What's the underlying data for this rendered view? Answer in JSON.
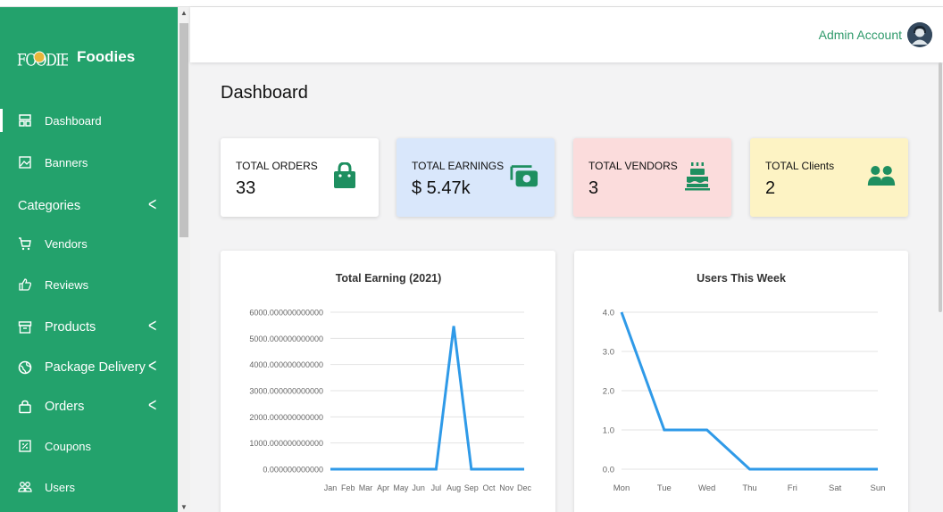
{
  "brand": {
    "name": "Foodies",
    "logo_text": "FOODIES"
  },
  "header": {
    "admin_label": "Admin Account"
  },
  "sidebar": {
    "items": [
      {
        "label": "Dashboard",
        "icon": "dashboard-icon",
        "has_chevron": false
      },
      {
        "label": "Banners",
        "icon": "image-icon",
        "has_chevron": false
      },
      {
        "label": "Categories",
        "icon": "",
        "has_chevron": true
      },
      {
        "label": "Vendors",
        "icon": "cart-icon",
        "has_chevron": false
      },
      {
        "label": "Reviews",
        "icon": "thumbs-up-icon",
        "has_chevron": false
      },
      {
        "label": "Products",
        "icon": "archive-icon",
        "has_chevron": true
      },
      {
        "label": "Package Delivery",
        "icon": "globe-icon",
        "has_chevron": true
      },
      {
        "label": "Orders",
        "icon": "bag-icon",
        "has_chevron": true
      },
      {
        "label": "Coupons",
        "icon": "coupon-icon",
        "has_chevron": false
      },
      {
        "label": "Users",
        "icon": "users-icon",
        "has_chevron": false
      }
    ],
    "chevron": "<"
  },
  "main": {
    "title": "Dashboard",
    "cards": [
      {
        "title": "TOTAL ORDERS",
        "value": "33",
        "icon": "shopping-bag-icon",
        "bg": "#ffffff"
      },
      {
        "title": "TOTAL EARNINGS",
        "value": "$ 5.47k",
        "icon": "money-icon",
        "bg": "#d9e7fb"
      },
      {
        "title": "TOTAL VENDORS",
        "value": "3",
        "icon": "cake-icon",
        "bg": "#fbdcdc"
      },
      {
        "title": "TOTAL Clients",
        "value": "2",
        "icon": "users-icon",
        "bg": "#fdf3c4"
      }
    ]
  },
  "colors": {
    "sidebar": "#23a26c",
    "accent": "#1e8f60",
    "line": "#2f9ae8"
  },
  "chart_data": [
    {
      "type": "line",
      "title": "Total Earning (2021)",
      "x": [
        "Jan",
        "Feb",
        "Mar",
        "Apr",
        "May",
        "Jun",
        "Jul",
        "Aug",
        "Sep",
        "Oct",
        "Nov",
        "Dec"
      ],
      "values": [
        0,
        0,
        0,
        0,
        0,
        0,
        0,
        5470,
        0,
        0,
        0,
        0
      ],
      "yticks": [
        "0.000000000000",
        "1000.000000000000",
        "2000.000000000000",
        "3000.000000000000",
        "4000.000000000000",
        "5000.000000000000",
        "6000.000000000000"
      ],
      "ylim": [
        0,
        6000
      ],
      "grid": true,
      "xlabel": "",
      "ylabel": ""
    },
    {
      "type": "line",
      "title": "Users This Week",
      "x": [
        "Mon",
        "Tue",
        "Wed",
        "Thu",
        "Fri",
        "Sat",
        "Sun"
      ],
      "values": [
        4,
        1,
        1,
        0,
        0,
        0,
        0
      ],
      "yticks": [
        "0.0",
        "1.0",
        "2.0",
        "3.0",
        "4.0"
      ],
      "ylim": [
        0,
        4
      ],
      "grid": true,
      "xlabel": "",
      "ylabel": ""
    }
  ]
}
